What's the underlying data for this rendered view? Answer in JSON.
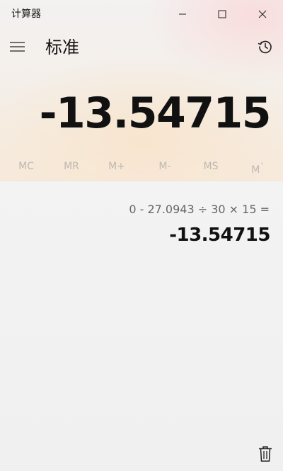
{
  "app": {
    "title": "计算器"
  },
  "window_controls": {
    "minimize_icon": "minimize-icon",
    "maximize_icon": "maximize-icon",
    "close_icon": "close-icon"
  },
  "header": {
    "menu_icon": "hamburger-menu-icon",
    "mode_title": "标准",
    "history_icon": "history-clock-icon"
  },
  "display": {
    "value": "-13.54715"
  },
  "memory": {
    "buttons": [
      "MC",
      "MR",
      "M+",
      "M-",
      "MS",
      "M"
    ],
    "dropdown_caret": "˅",
    "color_disabled": "#bdb8b3"
  },
  "history": {
    "items": [
      {
        "expression": "0   -   27.0943   ÷   30   ×   15 =",
        "result": "-13.54715"
      }
    ],
    "clear_icon": "trash-icon"
  },
  "colors": {
    "text": "#111111",
    "secondary_text": "#666666",
    "accent_warm": "#f7eadb",
    "accent_pink": "#fad6d6"
  }
}
